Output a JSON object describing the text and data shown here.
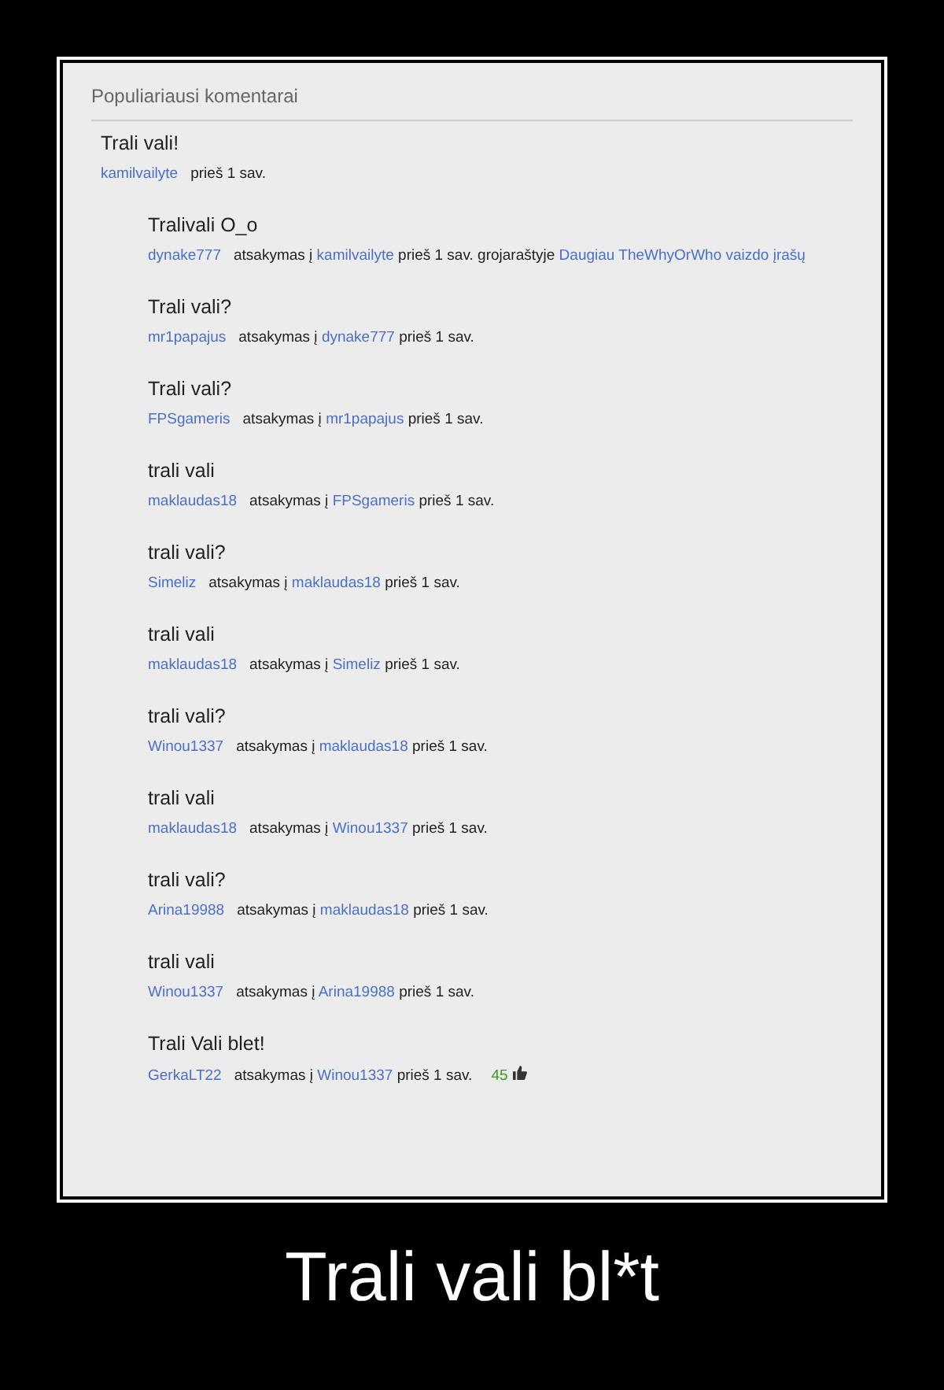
{
  "header": "Populiariausi komentarai",
  "comments": [
    {
      "kind": "comment",
      "text": "Trali vali!",
      "author": "kamilvailyte",
      "time": "prieš 1 sav."
    },
    {
      "kind": "reply",
      "text": "Tralivali O_o",
      "author": "dynake777",
      "reply_label": "atsakymas į",
      "reply_to": "kamilvailyte",
      "time": "prieš 1 sav.",
      "playlist_label": "grojaraštyje",
      "playlist": "Daugiau TheWhyOrWho vaizdo įrašų"
    },
    {
      "kind": "reply",
      "text": "Trali vali?",
      "author": "mr1papajus",
      "reply_label": "atsakymas į",
      "reply_to": "dynake777",
      "time": "prieš 1 sav."
    },
    {
      "kind": "reply",
      "text": "Trali vali?",
      "author": "FPSgameris",
      "reply_label": "atsakymas į",
      "reply_to": "mr1papajus",
      "time": "prieš 1 sav."
    },
    {
      "kind": "reply",
      "text": "trali vali",
      "author": "maklaudas18",
      "reply_label": "atsakymas į",
      "reply_to": "FPSgameris",
      "time": "prieš 1 sav."
    },
    {
      "kind": "reply",
      "text": "trali vali?",
      "author": "Simeliz",
      "reply_label": "atsakymas į",
      "reply_to": "maklaudas18",
      "time": "prieš 1 sav."
    },
    {
      "kind": "reply",
      "text": "trali vali",
      "author": "maklaudas18",
      "reply_label": "atsakymas į",
      "reply_to": "Simeliz",
      "time": "prieš 1 sav."
    },
    {
      "kind": "reply",
      "text": "trali vali?",
      "author": "Winou1337",
      "reply_label": "atsakymas į",
      "reply_to": "maklaudas18",
      "time": "prieš 1 sav."
    },
    {
      "kind": "reply",
      "text": "trali vali",
      "author": "maklaudas18",
      "reply_label": "atsakymas į",
      "reply_to": "Winou1337",
      "time": "prieš 1 sav."
    },
    {
      "kind": "reply",
      "text": "trali vali?",
      "author": "Arina19988",
      "reply_label": "atsakymas į",
      "reply_to": "maklaudas18",
      "time": "prieš 1 sav."
    },
    {
      "kind": "reply",
      "text": "trali vali",
      "author": "Winou1337",
      "reply_label": "atsakymas į",
      "reply_to": "Arina19988",
      "time": "prieš 1 sav."
    },
    {
      "kind": "reply",
      "text": "Trali Vali blet!",
      "author": "GerkaLT22",
      "reply_label": "atsakymas į",
      "reply_to": "Winou1337",
      "time": "prieš 1 sav.",
      "likes": "45"
    }
  ],
  "caption": "Trali vali bl*t"
}
